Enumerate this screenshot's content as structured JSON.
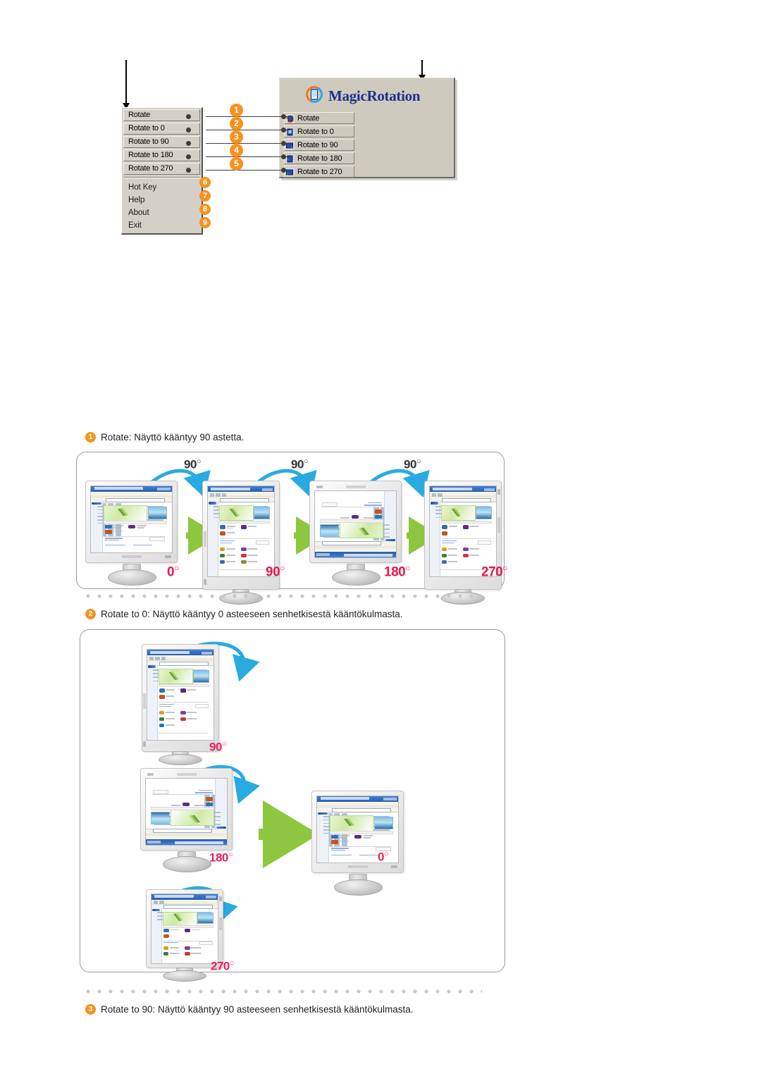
{
  "top_diagram": {
    "context_menu": {
      "name": "tray-context-menu",
      "buttons": [
        "Rotate",
        "Rotate to 0",
        "Rotate to 90",
        "Rotate to 180",
        "Rotate to 270"
      ],
      "items": [
        "Hot Key",
        "Help",
        "About",
        "Exit"
      ]
    },
    "app_panel": {
      "brand": "MagicRotation",
      "buttons": [
        {
          "label": "Rotate",
          "icon": "rotate-icon"
        },
        {
          "label": "Rotate to 0",
          "icon": "rotate-0-icon"
        },
        {
          "label": "Rotate to 90",
          "icon": "rotate-90-icon"
        },
        {
          "label": "Rotate to 180",
          "icon": "rotate-180-icon"
        },
        {
          "label": "Rotate to 270",
          "icon": "rotate-270-icon"
        }
      ]
    },
    "badges": [
      "1",
      "2",
      "3",
      "4",
      "5",
      "6",
      "7",
      "8",
      "9"
    ]
  },
  "sections": [
    {
      "number": "1",
      "caption": "Rotate:  Näyttö kääntyy 90 astetta.",
      "steps": [
        {
          "state": "0",
          "degree_label": "0",
          "rotation": 0
        },
        {
          "state": "90",
          "degree_label": "90",
          "rotation": 90
        },
        {
          "state": "180",
          "degree_label": "180",
          "rotation": 180
        },
        {
          "state": "270",
          "degree_label": "270",
          "rotation": 270
        }
      ],
      "arc_labels": [
        "90",
        "90",
        "90"
      ]
    },
    {
      "number": "2",
      "caption": "Rotate to 0: Näyttö kääntyy 0 asteeseen senhetkisestä kääntökulmasta.",
      "sources": [
        {
          "degree_label": "90"
        },
        {
          "degree_label": "180"
        },
        {
          "degree_label": "270"
        }
      ],
      "target": {
        "degree_label": "0"
      }
    },
    {
      "number": "3",
      "caption": "Rotate to 90: Näyttö kääntyy 90 asteeseen senhetkisestä kääntökulmasta."
    }
  ],
  "colors": {
    "badge_orange": "#f6921e",
    "degree_red": "#e8174b",
    "arrow_green": "#8dc63f",
    "arc_blue": "#29abe2",
    "brand_blue": "#1f2f8c",
    "panel_gray": "#cfcabe"
  }
}
